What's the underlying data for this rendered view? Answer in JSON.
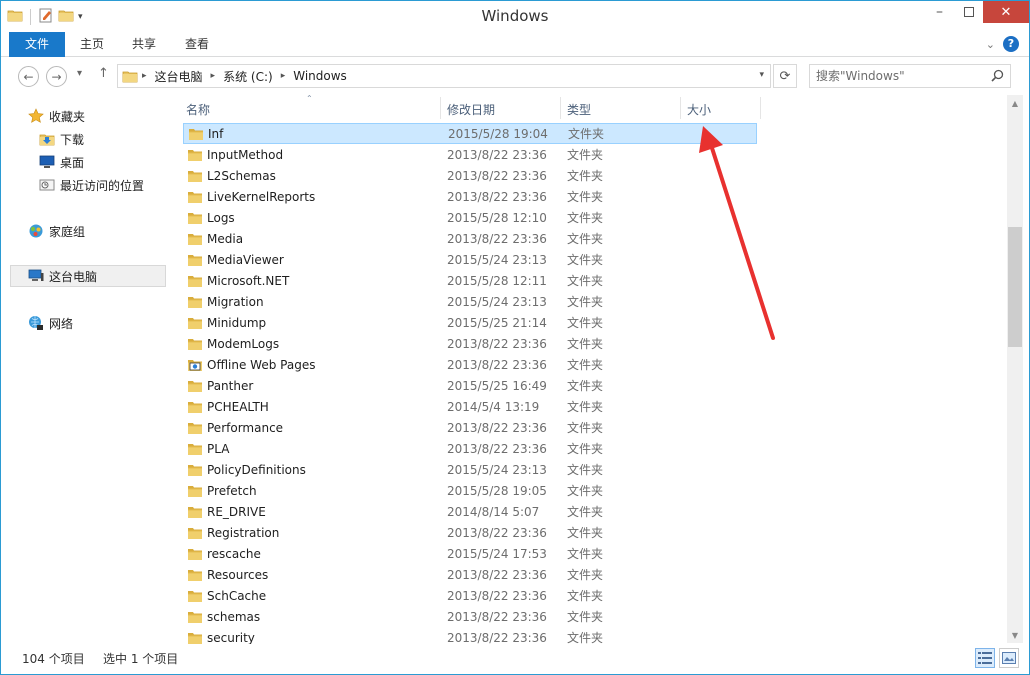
{
  "window": {
    "title": "Windows"
  },
  "ribbon": {
    "tabs": [
      {
        "label": "文件"
      },
      {
        "label": "主页"
      },
      {
        "label": "共享"
      },
      {
        "label": "查看"
      }
    ]
  },
  "address": {
    "crumbs": [
      "这台电脑",
      "系统 (C:)",
      "Windows"
    ]
  },
  "search": {
    "placeholder": "搜索\"Windows\""
  },
  "nav": {
    "favorites": "收藏夹",
    "downloads": "下载",
    "desktop": "桌面",
    "recent": "最近访问的位置",
    "homegroup": "家庭组",
    "thispc": "这台电脑",
    "network": "网络"
  },
  "columns": {
    "name": "名称",
    "date": "修改日期",
    "type": "类型",
    "size": "大小"
  },
  "files": [
    {
      "name": "Inf",
      "date": "2015/5/28 19:04",
      "type": "文件夹",
      "icon": "folder-icon",
      "selected": true
    },
    {
      "name": "InputMethod",
      "date": "2013/8/22 23:36",
      "type": "文件夹",
      "icon": "folder-icon"
    },
    {
      "name": "L2Schemas",
      "date": "2013/8/22 23:36",
      "type": "文件夹",
      "icon": "folder-icon"
    },
    {
      "name": "LiveKernelReports",
      "date": "2013/8/22 23:36",
      "type": "文件夹",
      "icon": "folder-icon"
    },
    {
      "name": "Logs",
      "date": "2015/5/28 12:10",
      "type": "文件夹",
      "icon": "folder-icon"
    },
    {
      "name": "Media",
      "date": "2013/8/22 23:36",
      "type": "文件夹",
      "icon": "folder-icon"
    },
    {
      "name": "MediaViewer",
      "date": "2015/5/24 23:13",
      "type": "文件夹",
      "icon": "folder-icon"
    },
    {
      "name": "Microsoft.NET",
      "date": "2015/5/28 12:11",
      "type": "文件夹",
      "icon": "folder-icon"
    },
    {
      "name": "Migration",
      "date": "2015/5/24 23:13",
      "type": "文件夹",
      "icon": "folder-icon"
    },
    {
      "name": "Minidump",
      "date": "2015/5/25 21:14",
      "type": "文件夹",
      "icon": "folder-icon"
    },
    {
      "name": "ModemLogs",
      "date": "2013/8/22 23:36",
      "type": "文件夹",
      "icon": "folder-icon"
    },
    {
      "name": "Offline Web Pages",
      "date": "2013/8/22 23:36",
      "type": "文件夹",
      "icon": "offline-pages-icon"
    },
    {
      "name": "Panther",
      "date": "2015/5/25 16:49",
      "type": "文件夹",
      "icon": "folder-icon"
    },
    {
      "name": "PCHEALTH",
      "date": "2014/5/4 13:19",
      "type": "文件夹",
      "icon": "folder-icon"
    },
    {
      "name": "Performance",
      "date": "2013/8/22 23:36",
      "type": "文件夹",
      "icon": "folder-icon"
    },
    {
      "name": "PLA",
      "date": "2013/8/22 23:36",
      "type": "文件夹",
      "icon": "folder-icon"
    },
    {
      "name": "PolicyDefinitions",
      "date": "2015/5/24 23:13",
      "type": "文件夹",
      "icon": "folder-icon"
    },
    {
      "name": "Prefetch",
      "date": "2015/5/28 19:05",
      "type": "文件夹",
      "icon": "folder-icon"
    },
    {
      "name": "RE_DRIVE",
      "date": "2014/8/14 5:07",
      "type": "文件夹",
      "icon": "folder-icon"
    },
    {
      "name": "Registration",
      "date": "2013/8/22 23:36",
      "type": "文件夹",
      "icon": "folder-icon"
    },
    {
      "name": "rescache",
      "date": "2015/5/24 17:53",
      "type": "文件夹",
      "icon": "folder-icon"
    },
    {
      "name": "Resources",
      "date": "2013/8/22 23:36",
      "type": "文件夹",
      "icon": "folder-icon"
    },
    {
      "name": "SchCache",
      "date": "2013/8/22 23:36",
      "type": "文件夹",
      "icon": "folder-icon"
    },
    {
      "name": "schemas",
      "date": "2013/8/22 23:36",
      "type": "文件夹",
      "icon": "folder-icon"
    },
    {
      "name": "security",
      "date": "2013/8/22 23:36",
      "type": "文件夹",
      "icon": "folder-icon"
    }
  ],
  "status": {
    "count": "104 个项目",
    "selection": "选中 1 个项目"
  },
  "colors": {
    "accent": "#1979ca",
    "selection_bg": "#cce8ff",
    "selection_border": "#99d1ff",
    "annotation_arrow": "#e8312f",
    "folder": "#e8c462"
  }
}
